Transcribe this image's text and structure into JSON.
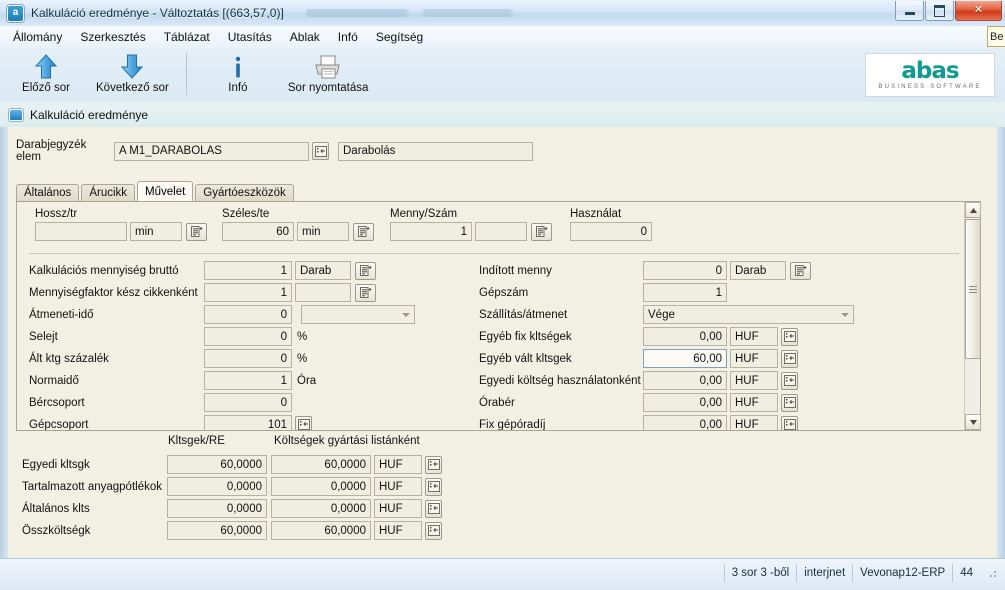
{
  "window": {
    "title": "Kalkuláció eredménye - Változtatás  [(663,57,0)]",
    "app_icon": "abas-app-icon",
    "minimize_label": "Minimize",
    "maximize_label": "Maximize",
    "close_label": "✕"
  },
  "menubar": {
    "items": [
      {
        "label": "Állomány"
      },
      {
        "label": "Szerkesztés"
      },
      {
        "label": "Táblázat"
      },
      {
        "label": "Utasítás"
      },
      {
        "label": "Ablak"
      },
      {
        "label": "Infó"
      },
      {
        "label": "Segítség"
      }
    ],
    "edge_tooltip": "Be"
  },
  "toolbar": {
    "buttons": [
      {
        "label": "Előző sor",
        "icon": "arrow-up-icon"
      },
      {
        "label": "Következő sor",
        "icon": "arrow-down-icon"
      },
      {
        "label": "Infó",
        "icon": "info-icon"
      },
      {
        "label": "Sor nyomtatása",
        "icon": "printer-icon"
      }
    ],
    "logo": {
      "word": "abas",
      "sub": "BUSINESS SOFTWARE"
    }
  },
  "header_strip": {
    "title": "Kalkuláció eredménye",
    "icon": "window-marker-icon"
  },
  "id_row": {
    "label": "Darabjegyzék elem",
    "code_value": "A M1_DARABOLAS",
    "lookup_icon": "lookup-icon",
    "description_value": "Darabolás"
  },
  "tabs": [
    {
      "label": "Általános",
      "active": false
    },
    {
      "label": "Árucikk",
      "active": false
    },
    {
      "label": "Művelet",
      "active": true
    },
    {
      "label": "Gyártóeszközök",
      "active": false
    }
  ],
  "measures": [
    {
      "caption": "Hossz/tr",
      "value": "",
      "unit": "min",
      "picker_icon": "list-picker-icon"
    },
    {
      "caption": "Széles/te",
      "value": "60",
      "unit": "min",
      "picker_icon": "list-picker-icon"
    },
    {
      "caption": "Menny/Szám",
      "value": "1",
      "unit": "",
      "picker_icon": "list-picker-icon"
    },
    {
      "caption": "Használat",
      "value": "0",
      "unit": "",
      "picker_icon": ""
    }
  ],
  "left_fields": [
    {
      "caption": "Kalkulációs mennyiség bruttó",
      "value": "1",
      "unit_value": "Darab",
      "unit_kind": "field",
      "button": "list-picker-icon"
    },
    {
      "caption": "Mennyiségfaktor kész cikkenként",
      "value": "1",
      "unit_value": "",
      "unit_kind": "field",
      "button": "list-picker-icon"
    },
    {
      "caption": "Átmeneti-idő",
      "value": "0",
      "unit_value": "",
      "unit_kind": "combo",
      "button": ""
    },
    {
      "caption": "Selejt",
      "value": "0",
      "unit_value": "%",
      "unit_kind": "text",
      "button": ""
    },
    {
      "caption": "Ált ktg százalék",
      "value": "0",
      "unit_value": "%",
      "unit_kind": "text",
      "button": ""
    },
    {
      "caption": "Normaidő",
      "value": "1",
      "unit_value": "Óra",
      "unit_kind": "text",
      "button": ""
    },
    {
      "caption": "Bércsoport",
      "value": "0",
      "unit_value": "",
      "unit_kind": "none",
      "button": ""
    },
    {
      "caption": "Gépcsoport",
      "value": "101",
      "unit_value": "",
      "unit_kind": "none",
      "button": "lookup-icon"
    }
  ],
  "right_fields": [
    {
      "caption": "Indított menny",
      "value": "0",
      "unit_value": "Darab",
      "unit_kind": "field",
      "button": "list-picker-icon"
    },
    {
      "caption": "Gépszám",
      "value": "1",
      "unit_value": "",
      "unit_kind": "none",
      "button": ""
    },
    {
      "caption": "Szállítás/átmenet",
      "value": "Vége",
      "unit_value": "",
      "unit_kind": "combo-wide",
      "button": ""
    },
    {
      "caption": "Egyéb fix kltségek",
      "value": "0,00",
      "unit_value": "HUF",
      "unit_kind": "field",
      "button": "lookup-icon"
    },
    {
      "caption": "Egyéb vált kltsgek",
      "value": "60,00",
      "unit_value": "HUF",
      "unit_kind": "field",
      "button": "lookup-icon",
      "focused": true
    },
    {
      "caption": "Egyedi költség használatonként",
      "value": "0,00",
      "unit_value": "HUF",
      "unit_kind": "field",
      "button": "lookup-icon"
    },
    {
      "caption": "Órabér",
      "value": "0,00",
      "unit_value": "HUF",
      "unit_kind": "field",
      "button": "lookup-icon"
    },
    {
      "caption": "Fix gépóradíj",
      "value": "0,00",
      "unit_value": "HUF",
      "unit_kind": "field",
      "button": "lookup-icon"
    }
  ],
  "cost_block": {
    "col_headers": [
      "Kltsgek/RE",
      "Költségek gyártási listánként"
    ],
    "rows": [
      {
        "caption": "Egyedi kltsgk",
        "per_re": "60,0000",
        "per_list": "60,0000",
        "currency": "HUF",
        "button": "lookup-icon"
      },
      {
        "caption": "Tartalmazott anyagpótlékok",
        "per_re": "0,0000",
        "per_list": "0,0000",
        "currency": "HUF",
        "button": "lookup-icon"
      },
      {
        "caption": "Általános klts",
        "per_re": "0,0000",
        "per_list": "0,0000",
        "currency": "HUF",
        "button": "lookup-icon"
      },
      {
        "caption": "Összköltségk",
        "per_re": "60,0000",
        "per_list": "60,0000",
        "currency": "HUF",
        "button": "lookup-icon"
      }
    ]
  },
  "statusbar": {
    "cells": [
      {
        "label": "3 sor 3 -ből"
      },
      {
        "label": "interjnet"
      },
      {
        "label": "Vevonap12-ERP"
      },
      {
        "label": "44"
      }
    ]
  },
  "colors": {
    "panel_bg": "#f2f0e3",
    "field_bg": "#f0eee1",
    "accent_teal": "#0f9a92",
    "title_bg": "#d3e4f6",
    "close_red": "#cf3a19"
  }
}
